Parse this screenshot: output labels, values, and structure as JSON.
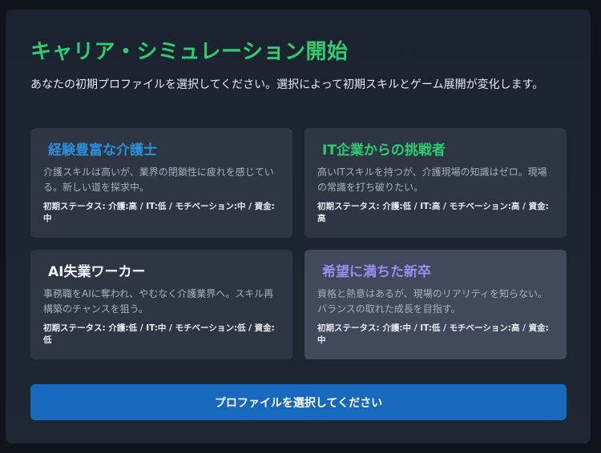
{
  "title": "キャリア・シミュレーション開始",
  "intro": "あなたの初期プロファイルを選択してください。選択によって初期スキルとゲーム展開が変化します。",
  "colors": {
    "title": "#2fcc71",
    "cta_background": "#1669bd"
  },
  "profiles": [
    {
      "title": "経験豊富な介護士",
      "title_color": "#2a8fd8",
      "description": "介護スキルは高いが、業界の閉鎖性に疲れを感じている。新しい道を探求中。",
      "stats": "初期ステータス: 介護:高 / IT:低 / モチベーション:中 / 資金:中"
    },
    {
      "title": "IT企業からの挑戦者",
      "title_color": "#2fcc71",
      "description": "高いITスキルを持つが、介護現場の知識はゼロ。現場の常識を打ち破りたい。",
      "stats": "初期ステータス: 介護:低 / IT:高 / モチベーション:高 / 資金:高"
    },
    {
      "title": "AI失業ワーカー",
      "title_color": "#f0f2f5",
      "description": "事務職をAIに奪われ、やむなく介護業界へ。スキル再構築のチャンスを狙う。",
      "stats": "初期ステータス: 介護:低 / IT:中 / モチベーション:低 / 資金:低"
    },
    {
      "title": "希望に満ちた新卒",
      "title_color": "#9b8cf0",
      "description": "資格と熱意はあるが、現場のリアリティを知らない。バランスの取れた成長を目指す。",
      "stats": "初期ステータス: 介護:中 / IT:低 / モチベーション:高 / 資金:中"
    }
  ],
  "cta_label": "プロファイルを選択してください"
}
